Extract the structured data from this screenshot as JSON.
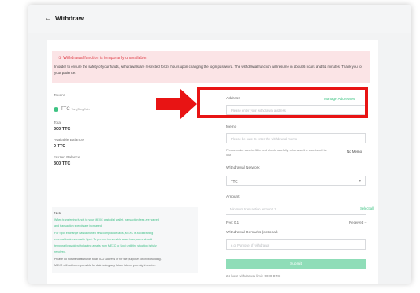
{
  "header": {
    "back_icon": "arrow-left-icon",
    "back_glyph": "←",
    "title": "Withdraw"
  },
  "notice": {
    "icon": "warning-icon",
    "title": "① Withdrawal function is temporarily unavailable.",
    "body": "In order to ensure the safety of your funds, withdrawals are restricted for 24 hours upon changing the login password. The withdrawal function will resume in about 6 hours and 51 minutes. Thank you for your patience."
  },
  "left": {
    "tokens_label": "Tokens",
    "token": {
      "symbol": "TTC",
      "full_name": "TangTangCoin",
      "icon": "token-icon"
    },
    "total_label": "Total",
    "total_value": "300 TTC",
    "available_label": "Available Balance",
    "available_value": "0 TTC",
    "frozen_label": "Frozen Balance",
    "frozen_value": "300 TTC"
  },
  "note": {
    "title": "Note",
    "lines": [
      "When transferring funds to your MEXC custodial wallet, transaction fees are waived",
      "and transaction speeds are increased.",
      "For Spot exchange has launched new compliance laws, MEXC is a contracting",
      "external businesses with Spot. To prevent irreversible asset loss, users should",
      "temporarily avoid withdrawing assets from MEXC to Spot until the situation is fully",
      "resolved.",
      "Please do not withdraw funds to an ICO address or for the purposes of crowdfunding.",
      "MEXC will not be responsible for distributing any future tokens you might receive."
    ]
  },
  "form": {
    "address_label": "Address",
    "manage_label": "Manage Addresses",
    "address_placeholder": "Please enter your withdrawal address",
    "memo_label": "Memo",
    "memo_placeholder": "Please be sure to enter the withdrawal memo",
    "memo_help": "Please make sure to fill in and check carefully, otherwise the assets will be lost",
    "no_memo": "No Memo",
    "network_label": "Withdrawal Network",
    "network_value": "TTC",
    "network_caret": "▾",
    "amount_label": "Amount",
    "amount_placeholder": "Minimum transaction amount: 1",
    "select_all": "Select all",
    "fee": "Fee: 0.1",
    "received": "Received --",
    "remarks_label": "Withdrawal Remarks (optional)",
    "remarks_placeholder": "e.g. Purpose of withdrawal",
    "submit": "Submit",
    "limit": "24-hour withdrawal limit: 5000 BTC"
  },
  "colors": {
    "accent": "#3ec383",
    "alert": "#e81414",
    "notice_bg": "#fbe4e6"
  }
}
